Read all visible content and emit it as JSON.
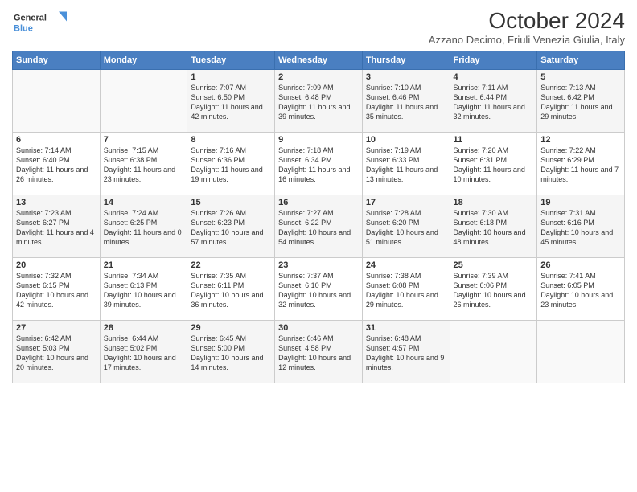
{
  "header": {
    "logo_line1": "General",
    "logo_line2": "Blue",
    "title": "October 2024",
    "subtitle": "Azzano Decimo, Friuli Venezia Giulia, Italy"
  },
  "weekdays": [
    "Sunday",
    "Monday",
    "Tuesday",
    "Wednesday",
    "Thursday",
    "Friday",
    "Saturday"
  ],
  "weeks": [
    [
      {
        "day": "",
        "sunrise": "",
        "sunset": "",
        "daylight": ""
      },
      {
        "day": "",
        "sunrise": "",
        "sunset": "",
        "daylight": ""
      },
      {
        "day": "1",
        "sunrise": "Sunrise: 7:07 AM",
        "sunset": "Sunset: 6:50 PM",
        "daylight": "Daylight: 11 hours and 42 minutes."
      },
      {
        "day": "2",
        "sunrise": "Sunrise: 7:09 AM",
        "sunset": "Sunset: 6:48 PM",
        "daylight": "Daylight: 11 hours and 39 minutes."
      },
      {
        "day": "3",
        "sunrise": "Sunrise: 7:10 AM",
        "sunset": "Sunset: 6:46 PM",
        "daylight": "Daylight: 11 hours and 35 minutes."
      },
      {
        "day": "4",
        "sunrise": "Sunrise: 7:11 AM",
        "sunset": "Sunset: 6:44 PM",
        "daylight": "Daylight: 11 hours and 32 minutes."
      },
      {
        "day": "5",
        "sunrise": "Sunrise: 7:13 AM",
        "sunset": "Sunset: 6:42 PM",
        "daylight": "Daylight: 11 hours and 29 minutes."
      }
    ],
    [
      {
        "day": "6",
        "sunrise": "Sunrise: 7:14 AM",
        "sunset": "Sunset: 6:40 PM",
        "daylight": "Daylight: 11 hours and 26 minutes."
      },
      {
        "day": "7",
        "sunrise": "Sunrise: 7:15 AM",
        "sunset": "Sunset: 6:38 PM",
        "daylight": "Daylight: 11 hours and 23 minutes."
      },
      {
        "day": "8",
        "sunrise": "Sunrise: 7:16 AM",
        "sunset": "Sunset: 6:36 PM",
        "daylight": "Daylight: 11 hours and 19 minutes."
      },
      {
        "day": "9",
        "sunrise": "Sunrise: 7:18 AM",
        "sunset": "Sunset: 6:34 PM",
        "daylight": "Daylight: 11 hours and 16 minutes."
      },
      {
        "day": "10",
        "sunrise": "Sunrise: 7:19 AM",
        "sunset": "Sunset: 6:33 PM",
        "daylight": "Daylight: 11 hours and 13 minutes."
      },
      {
        "day": "11",
        "sunrise": "Sunrise: 7:20 AM",
        "sunset": "Sunset: 6:31 PM",
        "daylight": "Daylight: 11 hours and 10 minutes."
      },
      {
        "day": "12",
        "sunrise": "Sunrise: 7:22 AM",
        "sunset": "Sunset: 6:29 PM",
        "daylight": "Daylight: 11 hours and 7 minutes."
      }
    ],
    [
      {
        "day": "13",
        "sunrise": "Sunrise: 7:23 AM",
        "sunset": "Sunset: 6:27 PM",
        "daylight": "Daylight: 11 hours and 4 minutes."
      },
      {
        "day": "14",
        "sunrise": "Sunrise: 7:24 AM",
        "sunset": "Sunset: 6:25 PM",
        "daylight": "Daylight: 11 hours and 0 minutes."
      },
      {
        "day": "15",
        "sunrise": "Sunrise: 7:26 AM",
        "sunset": "Sunset: 6:23 PM",
        "daylight": "Daylight: 10 hours and 57 minutes."
      },
      {
        "day": "16",
        "sunrise": "Sunrise: 7:27 AM",
        "sunset": "Sunset: 6:22 PM",
        "daylight": "Daylight: 10 hours and 54 minutes."
      },
      {
        "day": "17",
        "sunrise": "Sunrise: 7:28 AM",
        "sunset": "Sunset: 6:20 PM",
        "daylight": "Daylight: 10 hours and 51 minutes."
      },
      {
        "day": "18",
        "sunrise": "Sunrise: 7:30 AM",
        "sunset": "Sunset: 6:18 PM",
        "daylight": "Daylight: 10 hours and 48 minutes."
      },
      {
        "day": "19",
        "sunrise": "Sunrise: 7:31 AM",
        "sunset": "Sunset: 6:16 PM",
        "daylight": "Daylight: 10 hours and 45 minutes."
      }
    ],
    [
      {
        "day": "20",
        "sunrise": "Sunrise: 7:32 AM",
        "sunset": "Sunset: 6:15 PM",
        "daylight": "Daylight: 10 hours and 42 minutes."
      },
      {
        "day": "21",
        "sunrise": "Sunrise: 7:34 AM",
        "sunset": "Sunset: 6:13 PM",
        "daylight": "Daylight: 10 hours and 39 minutes."
      },
      {
        "day": "22",
        "sunrise": "Sunrise: 7:35 AM",
        "sunset": "Sunset: 6:11 PM",
        "daylight": "Daylight: 10 hours and 36 minutes."
      },
      {
        "day": "23",
        "sunrise": "Sunrise: 7:37 AM",
        "sunset": "Sunset: 6:10 PM",
        "daylight": "Daylight: 10 hours and 32 minutes."
      },
      {
        "day": "24",
        "sunrise": "Sunrise: 7:38 AM",
        "sunset": "Sunset: 6:08 PM",
        "daylight": "Daylight: 10 hours and 29 minutes."
      },
      {
        "day": "25",
        "sunrise": "Sunrise: 7:39 AM",
        "sunset": "Sunset: 6:06 PM",
        "daylight": "Daylight: 10 hours and 26 minutes."
      },
      {
        "day": "26",
        "sunrise": "Sunrise: 7:41 AM",
        "sunset": "Sunset: 6:05 PM",
        "daylight": "Daylight: 10 hours and 23 minutes."
      }
    ],
    [
      {
        "day": "27",
        "sunrise": "Sunrise: 6:42 AM",
        "sunset": "Sunset: 5:03 PM",
        "daylight": "Daylight: 10 hours and 20 minutes."
      },
      {
        "day": "28",
        "sunrise": "Sunrise: 6:44 AM",
        "sunset": "Sunset: 5:02 PM",
        "daylight": "Daylight: 10 hours and 17 minutes."
      },
      {
        "day": "29",
        "sunrise": "Sunrise: 6:45 AM",
        "sunset": "Sunset: 5:00 PM",
        "daylight": "Daylight: 10 hours and 14 minutes."
      },
      {
        "day": "30",
        "sunrise": "Sunrise: 6:46 AM",
        "sunset": "Sunset: 4:58 PM",
        "daylight": "Daylight: 10 hours and 12 minutes."
      },
      {
        "day": "31",
        "sunrise": "Sunrise: 6:48 AM",
        "sunset": "Sunset: 4:57 PM",
        "daylight": "Daylight: 10 hours and 9 minutes."
      },
      {
        "day": "",
        "sunrise": "",
        "sunset": "",
        "daylight": ""
      },
      {
        "day": "",
        "sunrise": "",
        "sunset": "",
        "daylight": ""
      }
    ]
  ]
}
